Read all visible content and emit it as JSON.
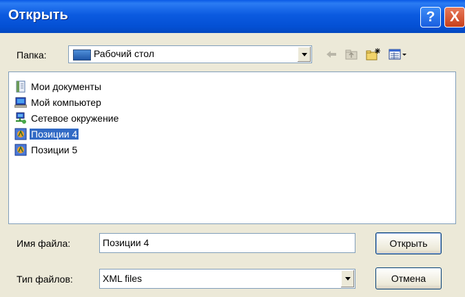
{
  "window": {
    "title": "Открыть",
    "help_label": "?",
    "close_label": "X"
  },
  "folder": {
    "label": "Папка:",
    "value": "Рабочий стол",
    "icon": "desktop-icon"
  },
  "toolbar": {
    "back_icon": "back-arrow-icon",
    "up_icon": "up-folder-icon",
    "new_folder_icon": "new-folder-icon",
    "views_icon": "views-menu-icon"
  },
  "files": [
    {
      "name": "Мои документы",
      "icon": "my-documents-icon",
      "selected": false
    },
    {
      "name": "Мой компьютер",
      "icon": "my-computer-icon",
      "selected": false
    },
    {
      "name": "Сетевое окружение",
      "icon": "network-places-icon",
      "selected": false
    },
    {
      "name": "Позиции 4",
      "icon": "xml-file-icon",
      "selected": true
    },
    {
      "name": "Позиции 5",
      "icon": "xml-file-icon",
      "selected": false
    }
  ],
  "filename": {
    "label": "Имя файла:",
    "value": "Позиции 4"
  },
  "filetype": {
    "label": "Тип файлов:",
    "value": "XML files"
  },
  "buttons": {
    "open": "Открыть",
    "cancel": "Отмена"
  },
  "colors": {
    "titlebar": "#0450d4",
    "dialog_bg": "#ece9d8",
    "selection": "#316ac5"
  }
}
